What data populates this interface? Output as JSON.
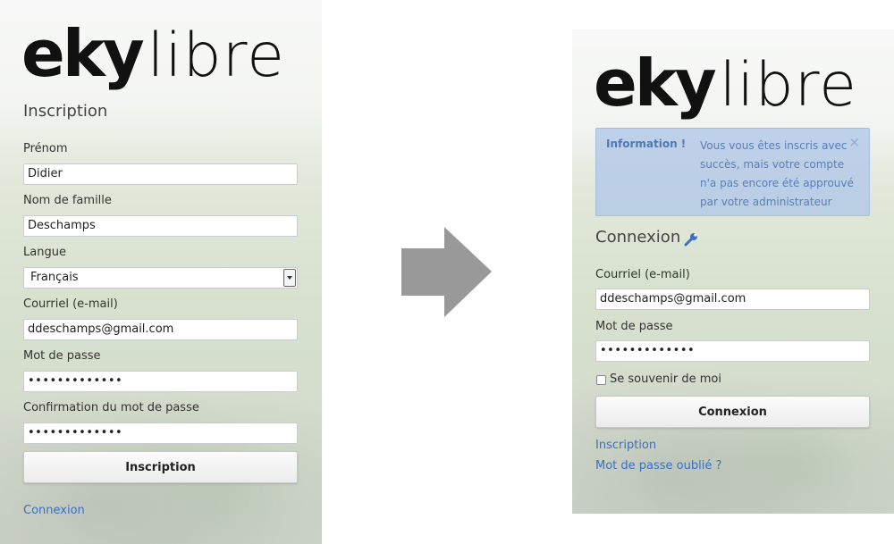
{
  "left": {
    "logo_bold": "eky",
    "logo_light": "libre",
    "title": "Inscription",
    "firstname_label": "Prénom",
    "firstname_value": "Didier",
    "lastname_label": "Nom de famille",
    "lastname_value": "Deschamps",
    "language_label": "Langue",
    "language_value": "Français",
    "email_label": "Courriel (e-mail)",
    "email_value": "ddeschamps@gmail.com",
    "password_label": "Mot de passe",
    "password_value": "•••••••••••••",
    "confirm_label": "Confirmation du mot de passe",
    "confirm_value": "•••••••••••••",
    "submit_label": "Inscription",
    "login_link": "Connexion"
  },
  "right": {
    "logo_bold": "eky",
    "logo_light": "libre",
    "alert_title": "Information !",
    "alert_message": "Vous vous êtes inscris avec succès, mais votre compte n'a pas encore été approuvé par votre administrateur",
    "alert_close": "×",
    "title": "Connexion",
    "title_icon": "wrench-icon",
    "email_label": "Courriel (e-mail)",
    "email_value": "ddeschamps@gmail.com",
    "password_label": "Mot de passe",
    "password_value": "•••••••••••••",
    "remember_label": "Se souvenir de moi",
    "submit_label": "Connexion",
    "register_link": "Inscription",
    "forgot_link": "Mot de passe oublié ?"
  },
  "colors": {
    "link": "#3a6fc4",
    "alert_bg": "#adc6e8",
    "arrow": "#999999"
  }
}
